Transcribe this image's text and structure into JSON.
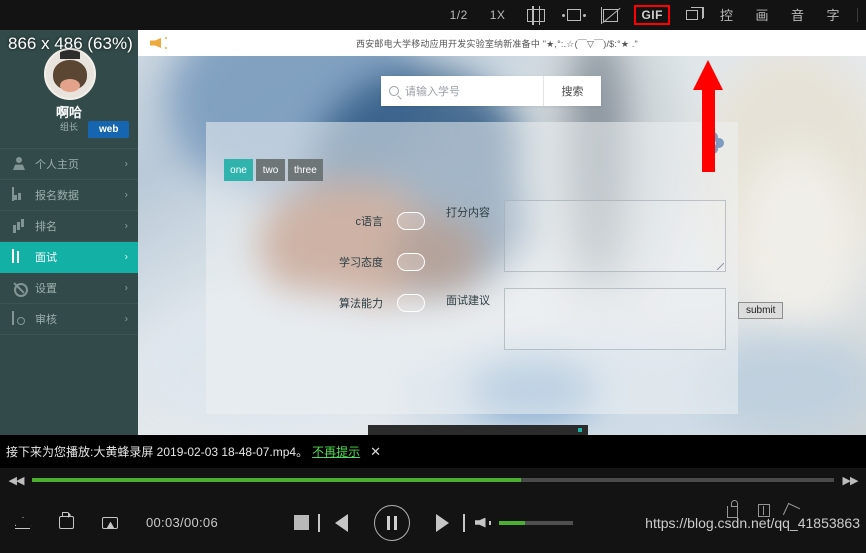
{
  "recorder_toolbar": {
    "items": [
      {
        "label": "1/2",
        "name": "half-speed-button",
        "type": "text"
      },
      {
        "label": "1X",
        "name": "one-x-speed-button",
        "type": "text"
      },
      {
        "label": "",
        "name": "vertical-split-frame-icon",
        "type": "icon-vsplit"
      },
      {
        "label": "",
        "name": "horizontal-expand-frame-icon",
        "type": "icon-hexp"
      },
      {
        "label": "",
        "name": "crop-frame-icon",
        "type": "icon-crop"
      },
      {
        "label": "GIF",
        "name": "gif-button",
        "type": "gif"
      },
      {
        "label": "",
        "name": "duplicate-window-icon",
        "type": "icon-dup"
      },
      {
        "label": "控",
        "name": "control-panel-button",
        "type": "cjk"
      },
      {
        "label": "画",
        "name": "video-settings-button",
        "type": "cjk"
      },
      {
        "label": "音",
        "name": "audio-settings-button",
        "type": "cjk"
      },
      {
        "label": "字",
        "name": "subtitle-settings-button",
        "type": "cjk"
      }
    ],
    "highlight_color": "#ff0000"
  },
  "overlay": {
    "zoom_label": "866 x 486 (63%)",
    "annotation_arrow_color": "#ff0000"
  },
  "web_app": {
    "notice": {
      "text": "西安邮电大学移动应用开发实验室纳新准备中  \"★,°:.☆(￣▽￣)/$:°★ .\""
    },
    "sidebar": {
      "user_name": "啊哈",
      "user_role": "组长",
      "badge": "web",
      "items": [
        {
          "label": "个人主页",
          "name": "sidebar-item-home",
          "icon": "person-icon",
          "active": false
        },
        {
          "label": "报名数据",
          "name": "sidebar-item-registration-data",
          "icon": "monitor-icon",
          "active": false
        },
        {
          "label": "排名",
          "name": "sidebar-item-ranking",
          "icon": "bar-chart-icon",
          "active": false
        },
        {
          "label": "面试",
          "name": "sidebar-item-interview",
          "icon": "book-icon",
          "active": true
        },
        {
          "label": "设置",
          "name": "sidebar-item-settings",
          "icon": "gear-icon",
          "active": false
        },
        {
          "label": "审核",
          "name": "sidebar-item-audit",
          "icon": "audit-icon",
          "active": false
        }
      ],
      "chevron": "›",
      "active_color": "#13b0a5",
      "background_color": "#324b4a"
    },
    "search": {
      "placeholder": "请输入学号",
      "value": "",
      "button_label": "搜索"
    },
    "card": {
      "tabs": [
        {
          "label": "one",
          "active": true
        },
        {
          "label": "two",
          "active": false
        },
        {
          "label": "three",
          "active": false
        }
      ],
      "score_fields": [
        {
          "label": "c语言",
          "value": ""
        },
        {
          "label": "学习态度",
          "value": ""
        },
        {
          "label": "算法能力",
          "value": ""
        }
      ],
      "textareas": [
        {
          "label": "打分内容",
          "value": ""
        },
        {
          "label": "面试建议",
          "value": ""
        }
      ],
      "submit_label": "submit"
    }
  },
  "player": {
    "notification": {
      "text": "接下来为您播放:大黄蜂录屏 2019-02-03 18-48-07.mp4。",
      "link_label": "不再提示",
      "link_color": "#4ddc4d",
      "close_label": "✕"
    },
    "seek": {
      "rewind_label": "◀◀",
      "forward_label": "▶▶",
      "progress_percent": 61,
      "progress_color": "#4caf2f"
    },
    "controls": {
      "time": "00:03/00:06",
      "eject_name": "eject-icon",
      "loop_name": "loop-icon",
      "screenshot_name": "screen-capture-icon",
      "stop_name": "stop-button",
      "previous_name": "previous-button",
      "pause_name": "pause-button",
      "next_name": "next-button",
      "volume_name": "volume-icon",
      "volume_percent": 36
    },
    "watermark": "https://blog.csdn.net/qq_41853863"
  }
}
